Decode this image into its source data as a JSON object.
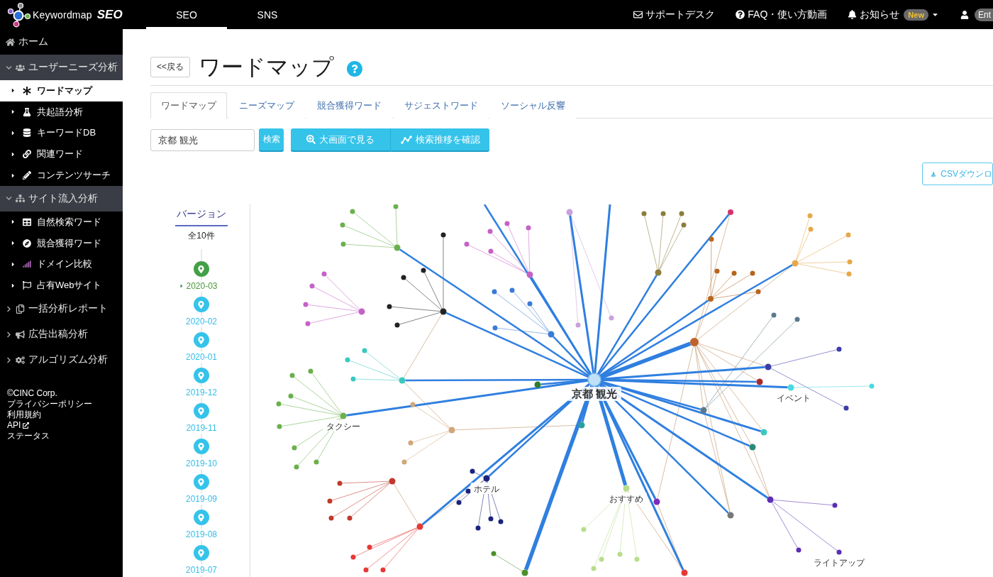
{
  "header": {
    "logo": {
      "name": "Keywordmap",
      "product": "SEO"
    },
    "nav_tabs": [
      {
        "label": "SEO",
        "selected": true
      },
      {
        "label": "SNS",
        "selected": false
      }
    ],
    "links": [
      {
        "label": "サポートデスク",
        "dropdown": false
      },
      {
        "label": "FAQ・使い方動画",
        "dropdown": false
      },
      {
        "label": "お知らせ",
        "badge": "New",
        "dropdown": true
      }
    ],
    "user": {
      "label": "Ent"
    }
  },
  "sidebar": {
    "items": [
      {
        "kind": "link",
        "label": "ホーム"
      },
      {
        "kind": "group",
        "label": "ユーザーニーズ分析",
        "expanded": true,
        "children": [
          {
            "label": "ワードマップ",
            "selected": true
          },
          {
            "label": "共起語分析",
            "selected": false
          },
          {
            "label": "キーワードDB",
            "selected": false
          },
          {
            "label": "関連ワード",
            "selected": false
          },
          {
            "label": "コンテンツサーチ",
            "selected": false
          }
        ]
      },
      {
        "kind": "group",
        "label": "サイト流入分析",
        "expanded": true,
        "children": [
          {
            "label": "自然検索ワード",
            "selected": false
          },
          {
            "label": "競合獲得ワード",
            "selected": false
          },
          {
            "label": "ドメイン比較",
            "selected": false
          },
          {
            "label": "占有Webサイト",
            "selected": false
          }
        ]
      },
      {
        "kind": "group",
        "label": "一括分析レポート",
        "expanded": false
      },
      {
        "kind": "group",
        "label": "広告出稿分析",
        "expanded": false
      },
      {
        "kind": "group",
        "label": "アルゴリズム分析",
        "expanded": false
      }
    ],
    "footer": [
      {
        "label": "©CINC Corp.",
        "external": false
      },
      {
        "label": "プライバシーポリシー",
        "external": false
      },
      {
        "label": "利用規約",
        "external": false
      },
      {
        "label": "API",
        "external": true
      },
      {
        "label": "ステータス",
        "external": false
      }
    ]
  },
  "page_header": {
    "back": "<<戻る",
    "title": "ワードマップ"
  },
  "tabs": [
    {
      "label": "ワードマップ",
      "selected": true
    },
    {
      "label": "ニーズマップ",
      "selected": false
    },
    {
      "label": "競合獲得ワード",
      "selected": false
    },
    {
      "label": "サジェストワード",
      "selected": false
    },
    {
      "label": "ソーシャル反響",
      "selected": false
    }
  ],
  "search": {
    "value": "京都 観光",
    "button": "検索"
  },
  "actions": [
    "大画面で見る",
    "検索推移を確認"
  ],
  "csv_button": "CSVダウンロ",
  "versions": {
    "heading": "バージョン",
    "count": "全10件",
    "items": [
      {
        "date": "2020-03",
        "selected": true
      },
      {
        "date": "2020-02",
        "selected": false
      },
      {
        "date": "2020-01",
        "selected": false
      },
      {
        "date": "2019-12",
        "selected": false
      },
      {
        "date": "2019-11",
        "selected": false
      },
      {
        "date": "2019-10",
        "selected": false
      },
      {
        "date": "2019-09",
        "selected": false
      },
      {
        "date": "2019-08",
        "selected": false
      },
      {
        "date": "2019-07",
        "selected": false
      }
    ]
  },
  "graph": {
    "center": "京都 観光",
    "labels": [
      "おすすめ",
      "タクシー",
      "ホテル",
      "イベント",
      "ライトアップ"
    ]
  }
}
